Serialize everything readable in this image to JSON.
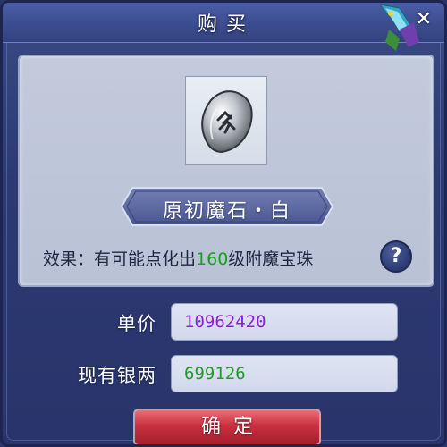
{
  "dialog": {
    "title": "购买",
    "close_glyph": "✕"
  },
  "item": {
    "icon": "rune-stone-icon",
    "name": "原初魔石・白",
    "effect_prefix": "效果：有可能点化出",
    "effect_level": "160",
    "effect_suffix": "级附魔宝珠",
    "help_glyph": "?"
  },
  "purchase": {
    "price_label": "单价",
    "price_value": "10962420",
    "silver_label": "现有银两",
    "silver_value": "699126",
    "confirm_label": "确定"
  },
  "colors": {
    "price": "#8d1fd4",
    "silver": "#1d9d24",
    "effect_level": "#16a01c",
    "confirm_button": "#c8313f"
  }
}
